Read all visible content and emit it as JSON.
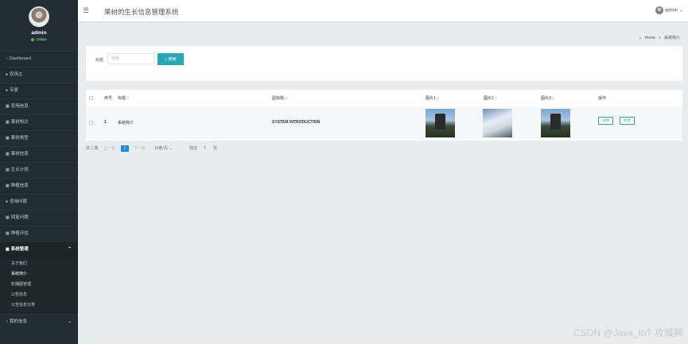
{
  "app": {
    "title": "果树的生长信息管理系统"
  },
  "profile": {
    "name": "admin",
    "status": "Online"
  },
  "sidebar": {
    "items": [
      {
        "icon": "circle-icon",
        "label": "Dashboard"
      },
      {
        "icon": "bullet-icon",
        "label": "农场主"
      },
      {
        "icon": "bullet-icon",
        "label": "专家"
      },
      {
        "icon": "grid-icon",
        "label": "农场信息"
      },
      {
        "icon": "grid-icon",
        "label": "果树知识"
      },
      {
        "icon": "grid-icon",
        "label": "果树类型"
      },
      {
        "icon": "grid-icon",
        "label": "果树信息"
      },
      {
        "icon": "grid-icon",
        "label": "生长计划"
      },
      {
        "icon": "grid-icon",
        "label": "种植信息"
      },
      {
        "icon": "bullet-icon",
        "label": "咨询问题"
      },
      {
        "icon": "grid-icon",
        "label": "回复问题"
      },
      {
        "icon": "grid-icon",
        "label": "种植评估"
      },
      {
        "icon": "grid-icon",
        "label": "系统管理"
      },
      {
        "icon": "circle-icon",
        "label": "我的信息"
      }
    ],
    "submenu": [
      {
        "label": "关于我们"
      },
      {
        "label": "系统简介"
      },
      {
        "label": "轮播图管理"
      },
      {
        "label": "公告信息"
      },
      {
        "label": "公告信息分类"
      }
    ]
  },
  "header": {
    "user": "admin"
  },
  "breadcrumb": {
    "home": "Home",
    "separator": ">",
    "current": "系统简介"
  },
  "search": {
    "label": "标题",
    "placeholder": "标题",
    "button": "搜索"
  },
  "table": {
    "headers": [
      "序号",
      "标题",
      "副标题",
      "图片1",
      "图片2",
      "图片3",
      "操作"
    ],
    "rows": [
      {
        "index": "1",
        "title": "系统简介",
        "subtitle": "SYSTEM INTRODUCTION",
        "detail": "详情",
        "edit": "修改"
      }
    ]
  },
  "pagination": {
    "total": "共 1 条",
    "prev": "上一页",
    "current": "1",
    "next": "下一页",
    "page_size": "10条/页",
    "goto_label": "前往",
    "goto_value": "1",
    "page_unit": "页"
  },
  "watermark": "CSDN @Java_IoT 攻城狮",
  "colors": {
    "sidebar": "#212d33",
    "accent": "#27a9b5",
    "page_current": "#1e88e5"
  }
}
